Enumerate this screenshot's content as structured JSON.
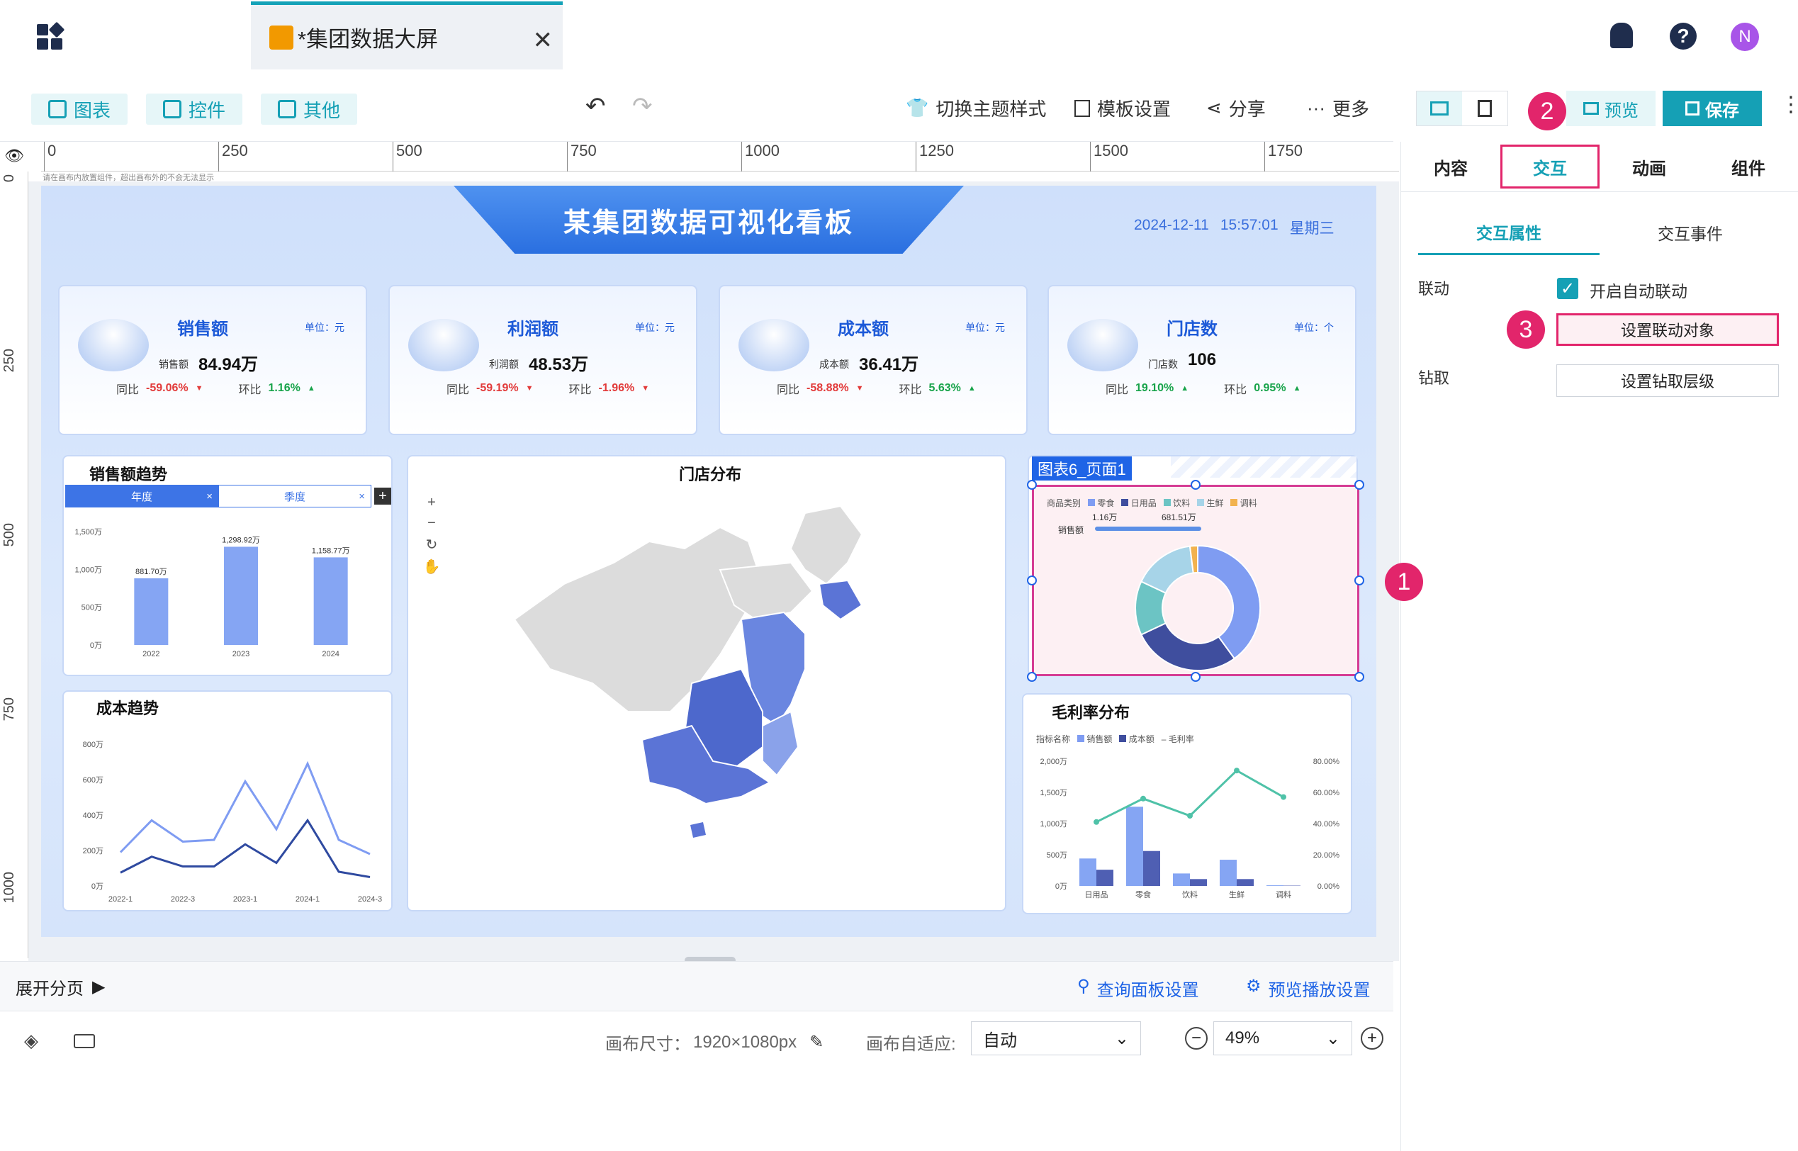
{
  "tab": {
    "title": "*集团数据大屏"
  },
  "toolbar": {
    "chart": "图表",
    "control": "控件",
    "other": "其他",
    "theme": "切换主题样式",
    "template": "模板设置",
    "share": "分享",
    "more": "更多",
    "preview": "预览",
    "save": "保存"
  },
  "ruler": {
    "ticks": [
      "0",
      "250",
      "500",
      "750",
      "1000",
      "1250",
      "1500",
      "1750"
    ],
    "vticks": [
      "0",
      "250",
      "500",
      "750",
      "1000"
    ],
    "hint": "请在画布内放置组件，超出画布外的不会无法显示"
  },
  "board": {
    "title": "某集团数据可视化看板",
    "date": "2024-12-11",
    "time": "15:57:01",
    "weekday": "星期三"
  },
  "kpis": [
    {
      "name": "销售额",
      "unit": "单位：元",
      "sub": "销售额",
      "value": "84.94万",
      "yoy_label": "同比",
      "yoy": "-59.06%",
      "mom_label": "环比",
      "mom": "1.16%",
      "mom_up": true
    },
    {
      "name": "利润额",
      "unit": "单位：元",
      "sub": "利润额",
      "value": "48.53万",
      "yoy_label": "同比",
      "yoy": "-59.19%",
      "mom_label": "环比",
      "mom": "-1.96%",
      "mom_up": false
    },
    {
      "name": "成本额",
      "unit": "单位：元",
      "sub": "成本额",
      "value": "36.41万",
      "yoy_label": "同比",
      "yoy": "-58.88%",
      "mom_label": "环比",
      "mom": "5.63%",
      "mom_up": true
    },
    {
      "name": "门店数",
      "unit": "单位：个",
      "sub": "门店数",
      "value": "106",
      "yoy_label": "同比",
      "yoy": "19.10%",
      "mom_label": "环比",
      "mom": "0.95%",
      "mom_up": true
    }
  ],
  "sales_trend": {
    "title": "销售额趋势",
    "tab_year": "年度",
    "tab_season": "季度"
  },
  "cost_trend": {
    "title": "成本趋势"
  },
  "store_map": {
    "title": "门店分布"
  },
  "donut": {
    "selected_label": "图表6_页面1",
    "legend_title": "商品类别",
    "legend": [
      "零食",
      "日用品",
      "饮料",
      "生鲜",
      "调料"
    ],
    "range_min": "1.16万",
    "range_max": "681.51万",
    "slider_label": "销售额"
  },
  "gross": {
    "title": "毛利率分布",
    "legend_title": "指标名称",
    "legend": [
      "销售额",
      "成本额",
      "毛利率"
    ]
  },
  "right": {
    "tabs": [
      "内容",
      "交互",
      "动画",
      "组件"
    ],
    "subtabs": [
      "交互属性",
      "交互事件"
    ],
    "link_label": "联动",
    "auto_link": "开启自动联动",
    "set_link": "设置联动对象",
    "drill_label": "钻取",
    "set_drill": "设置钻取层级"
  },
  "bottom": {
    "expand": "展开分页",
    "query": "查询面板设置",
    "playback": "预览播放设置"
  },
  "status": {
    "size_label": "画布尺寸：",
    "size": "1920×1080px",
    "fit_label": "画布自适应:",
    "fit": "自动",
    "zoom": "49%"
  },
  "callouts": [
    "1",
    "2",
    "3"
  ],
  "user": {
    "avatar": "N"
  },
  "colors": {
    "accent": "#15a0b5",
    "brand_blue": "#1f64e6",
    "callout": "#e2256b"
  },
  "chart_data": [
    {
      "type": "bar",
      "title": "销售额趋势",
      "categories": [
        "2022",
        "2023",
        "2024"
      ],
      "values": [
        881.7,
        1298.92,
        1158.77
      ],
      "data_labels": [
        "881.70万",
        "1,298.92万",
        "1,158.77万"
      ],
      "ytick_labels": [
        "0万",
        "500万",
        "1,000万",
        "1,500万"
      ],
      "ylim": [
        0,
        1500
      ]
    },
    {
      "type": "line",
      "title": "成本趋势",
      "categories": [
        "2022-1",
        "2022-2",
        "2022-3",
        "2022-4",
        "2023-1",
        "2023-2",
        "2023-3",
        "2023-4",
        "2024-1",
        "2024-2",
        "2024-3"
      ],
      "series": [
        {
          "values": [
            190,
            370,
            250,
            260,
            590,
            320,
            690,
            260,
            180
          ]
        },
        {
          "values": [
            75,
            165,
            110,
            110,
            235,
            130,
            370,
            80,
            50
          ]
        }
      ],
      "xtick_labels": [
        "2022-1",
        "2022-3",
        "2023-1",
        "2024-1",
        "2024-3"
      ],
      "ytick_labels": [
        "0万",
        "200万",
        "400万",
        "600万",
        "800万"
      ],
      "ylim": [
        0,
        800
      ]
    },
    {
      "type": "bar",
      "title": "毛利率分布",
      "categories": [
        "日用品",
        "零食",
        "饮料",
        "生鲜",
        "调料"
      ],
      "series": [
        {
          "name": "销售额",
          "values": [
            440,
            1270,
            200,
            420,
            10
          ]
        },
        {
          "name": "成本额",
          "values": [
            260,
            560,
            110,
            110,
            5
          ]
        },
        {
          "name": "毛利率",
          "values": [
            0.41,
            0.56,
            0.45,
            0.74,
            0.57
          ]
        }
      ],
      "ytick_labels": [
        "0万",
        "500万",
        "1,000万",
        "1,500万",
        "2,000万"
      ],
      "y2tick_labels": [
        "0.00%",
        "20.00%",
        "40.00%",
        "60.00%",
        "80.00%"
      ],
      "ylim": [
        0,
        2000
      ],
      "y2lim": [
        0,
        0.8
      ]
    },
    {
      "type": "pie",
      "title": "",
      "categories": [
        "零食",
        "日用品",
        "饮料",
        "生鲜",
        "调料"
      ],
      "values": [
        40,
        28,
        14,
        16,
        2
      ]
    }
  ]
}
